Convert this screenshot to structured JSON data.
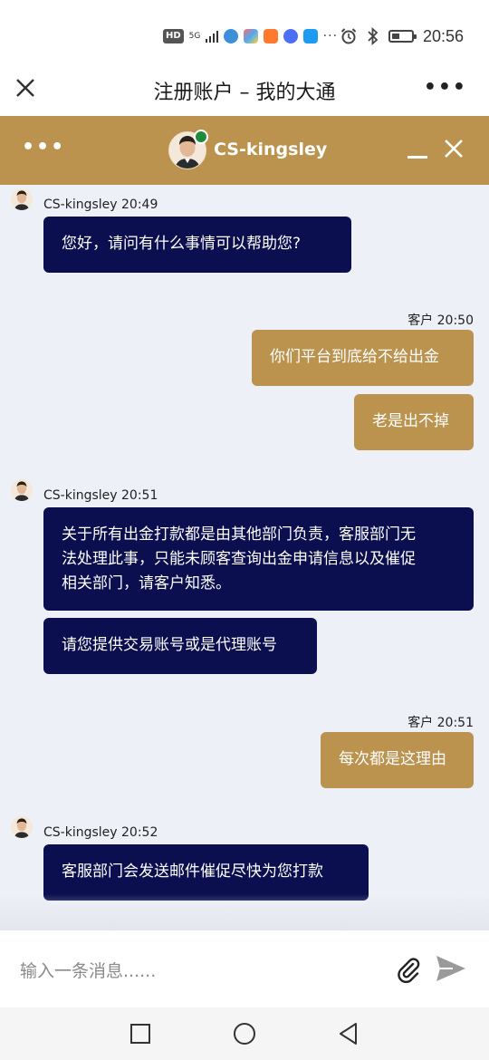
{
  "status_bar": {
    "time": "20:56",
    "network_badge": "HD",
    "network_type": "5G",
    "overflow": "···"
  },
  "title_bar": {
    "title": "注册账户 – 我的大通",
    "more": "•••"
  },
  "chat_header": {
    "menu": "•••",
    "agent_name": "CS-kingsley",
    "online_color": "#1e8a3c"
  },
  "messages": [
    {
      "sender": "CS-kingsley",
      "time": "20:49",
      "type": "agent",
      "bubbles": [
        [
          "您好，请问有什么事情可以帮助您?"
        ]
      ]
    },
    {
      "sender": "客户",
      "time": "20:50",
      "type": "customer",
      "bubbles": [
        [
          "你们平台到底给不给出金"
        ],
        [
          "老是出不掉"
        ]
      ]
    },
    {
      "sender": "CS-kingsley",
      "time": "20:51",
      "type": "agent",
      "bubbles": [
        [
          "关于所有出金打款都是由其他部门负责，客服部门无",
          "法处理此事，只能未顾客查询出金申请信息以及催促",
          "相关部门，请客户知悉。"
        ],
        [
          "请您提供交易账号或是代理账号"
        ]
      ]
    },
    {
      "sender": "客户",
      "time": "20:51",
      "type": "customer",
      "bubbles": [
        [
          "每次都是这理由"
        ]
      ]
    },
    {
      "sender": "CS-kingsley",
      "time": "20:52",
      "type": "agent",
      "bubbles": [
        [
          "客服部门会发送邮件催促尽快为您打款"
        ]
      ]
    }
  ],
  "input": {
    "placeholder": "输入一条消息......"
  },
  "icons": {
    "attach": "paperclip-icon",
    "send": "send-icon",
    "back": "nav-back-icon",
    "home": "nav-home-icon",
    "recent": "nav-recent-icon"
  },
  "colors": {
    "header_bg": "#bb934e",
    "agent_bubble": "#0b0f4f",
    "customer_bubble": "#bb934e",
    "chat_bg": "#eef0f7"
  }
}
